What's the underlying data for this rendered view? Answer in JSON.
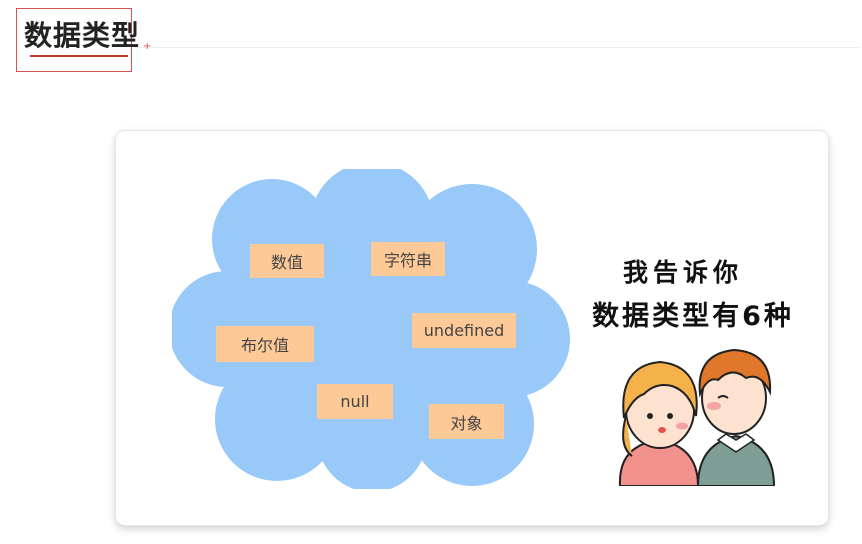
{
  "heading": {
    "title": "数据类型"
  },
  "card": {
    "types": [
      {
        "label": "数值"
      },
      {
        "label": "字符串"
      },
      {
        "label": "undefined"
      },
      {
        "label": "布尔值"
      },
      {
        "label": "null"
      },
      {
        "label": "对象"
      }
    ],
    "caption_line1": "我告诉你",
    "caption_line2": "数据类型有6种"
  },
  "colors": {
    "cloud": "#99c9f8",
    "chip": "#fdc997",
    "accent_red": "#d9534f"
  }
}
